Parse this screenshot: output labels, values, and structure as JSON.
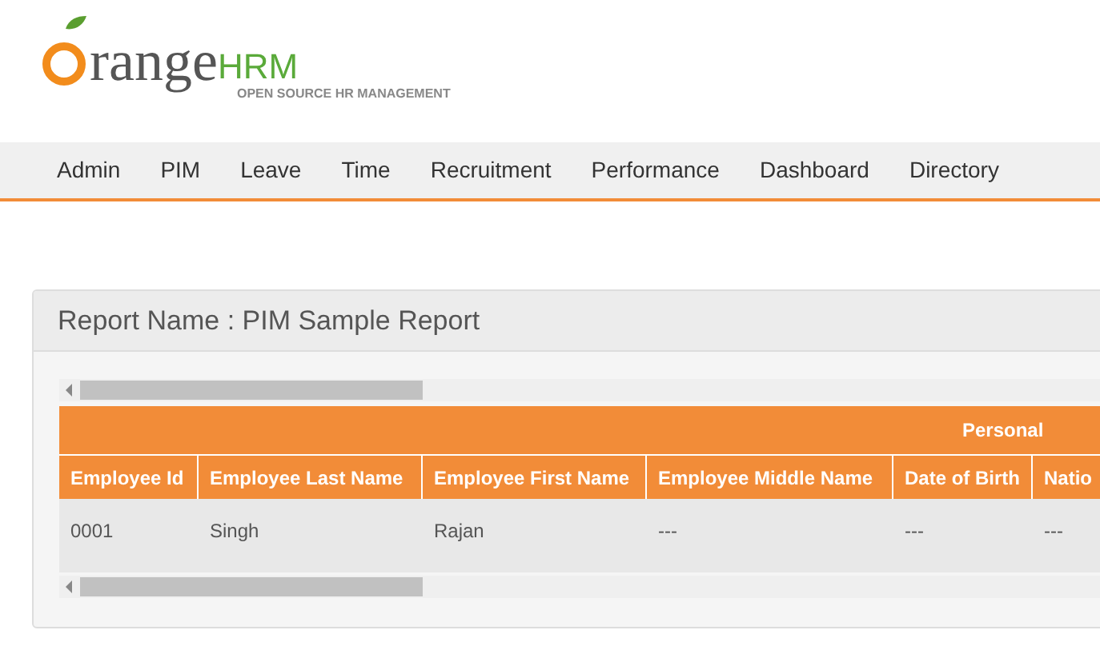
{
  "logo": {
    "text": "range",
    "accent": "HRM",
    "tagline": "OPEN SOURCE HR MANAGEMENT"
  },
  "menu": [
    {
      "label": "Admin"
    },
    {
      "label": "PIM"
    },
    {
      "label": "Leave"
    },
    {
      "label": "Time"
    },
    {
      "label": "Recruitment"
    },
    {
      "label": "Performance"
    },
    {
      "label": "Dashboard"
    },
    {
      "label": "Directory"
    }
  ],
  "report": {
    "title": "Report Name : PIM Sample Report",
    "group_header": "Personal",
    "columns": [
      "Employee Id",
      "Employee Last Name",
      "Employee First Name",
      "Employee Middle Name",
      "Date of Birth",
      "Natio"
    ],
    "rows": [
      [
        "0001",
        "Singh",
        "Rajan",
        "---",
        "---",
        "---"
      ]
    ]
  }
}
